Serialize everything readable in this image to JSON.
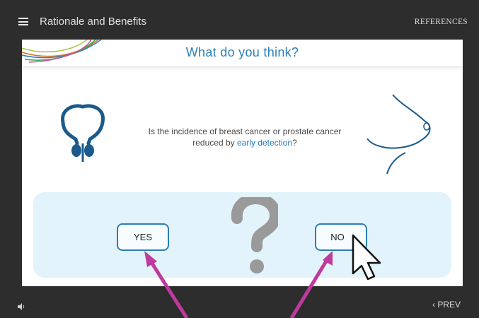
{
  "topbar": {
    "menu_icon": "hamburger-menu-icon",
    "title": "Rationale and Benefits",
    "references_label": "REFERENCES"
  },
  "slide": {
    "heading": "What do you think?",
    "question_pre": "Is the incidence of breast cancer or prostate cancer reduced by ",
    "question_highlight": "early detection",
    "question_post": "?",
    "left_icon": "prostate-icon",
    "right_icon": "breast-icon",
    "center_icon": "question-mark-icon",
    "yes_label": "YES",
    "no_label": "NO"
  },
  "footer": {
    "audio_icon": "speaker-icon",
    "prev_label": "PREV",
    "prev_icon": "chevron-left-icon"
  },
  "colors": {
    "accent": "#2a7fb8",
    "highlight": "#1c78c0",
    "panel_bg": "#e2f3fb",
    "annotation_arrow": "#c0399e",
    "frame": "#2d2d2d"
  }
}
